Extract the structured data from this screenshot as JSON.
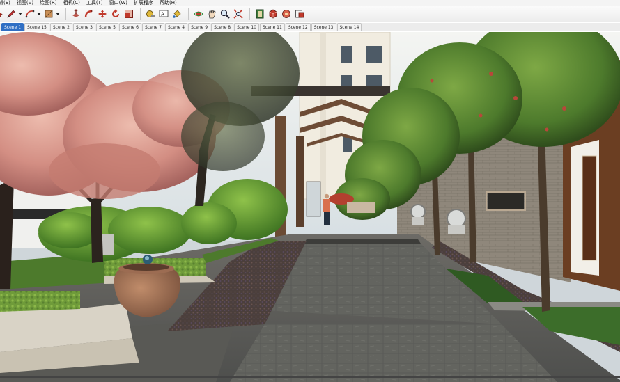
{
  "menubar": {
    "items": [
      {
        "label": "辑(E)"
      },
      {
        "label": "视图(V)"
      },
      {
        "label": "绘图(R)"
      },
      {
        "label": "相机(C)"
      },
      {
        "label": "工具(T)"
      },
      {
        "label": "窗口(W)"
      },
      {
        "label": "扩展程序"
      },
      {
        "label": "帮助(H)"
      }
    ]
  },
  "toolbar": {
    "tools": [
      {
        "icon": "select-icon"
      },
      {
        "icon": "pencil-icon"
      },
      {
        "icon": "arc-icon"
      },
      {
        "icon": "shape-icon"
      },
      {
        "icon": "push-pull-icon"
      },
      {
        "icon": "follow-me-icon"
      },
      {
        "icon": "move-icon"
      },
      {
        "icon": "rotate-icon"
      },
      {
        "icon": "scale-icon"
      },
      {
        "icon": "tape-measure-icon"
      },
      {
        "icon": "text-icon"
      },
      {
        "icon": "paint-bucket-icon"
      },
      {
        "icon": "orbit-icon"
      },
      {
        "icon": "pan-icon"
      },
      {
        "icon": "zoom-icon"
      },
      {
        "icon": "zoom-extents-icon"
      },
      {
        "icon": "warehouse-icon"
      },
      {
        "icon": "extension-warehouse-icon"
      },
      {
        "icon": "components-icon"
      },
      {
        "icon": "materials-icon"
      }
    ]
  },
  "scenes": {
    "tabs": [
      {
        "label": "Scene 1",
        "active": true
      },
      {
        "label": "Scene 15"
      },
      {
        "label": "Scene 2"
      },
      {
        "label": "Scene 3"
      },
      {
        "label": "Scene 5"
      },
      {
        "label": "Scene 6"
      },
      {
        "label": "Scene 7"
      },
      {
        "label": "Scene 4"
      },
      {
        "label": "Scene 9"
      },
      {
        "label": "Scene 8"
      },
      {
        "label": "Scene 10"
      },
      {
        "label": "Scene 11"
      },
      {
        "label": "Scene 12"
      },
      {
        "label": "Scene 13"
      },
      {
        "label": "Scene 14"
      }
    ],
    "active_color": "#2f6fc4"
  },
  "viewport": {
    "scene_colors": {
      "sky": "#e9ecef",
      "building": "#f1ece0",
      "pavement": "#5e5f5c",
      "cherry_blossom": "#d79a8f",
      "foliage": "#4e7a2c",
      "wall": "#8f877b"
    }
  }
}
